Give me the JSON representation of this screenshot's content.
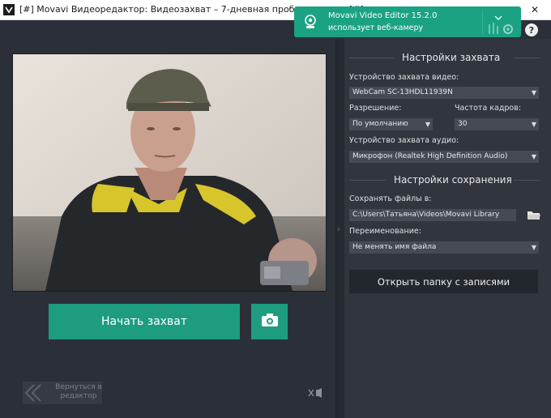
{
  "window": {
    "title": "[#] Movavi Видеоредактор: Видеозахват – 7-дневная пробная версия [#]",
    "minimize_glyph": "—",
    "close_glyph": "✕"
  },
  "notification": {
    "title": "Movavi Video Editor 15.2.0",
    "subtitle": "использует веб-камеру",
    "icon": "webcam-icon"
  },
  "help_glyph": "?",
  "capture": {
    "start_label": "Начать захват",
    "snapshot_icon": "camera-icon"
  },
  "back": {
    "label": "Вернуться в редактор",
    "icon": "double-chevron-left-icon"
  },
  "right_panel": {
    "capture_settings_title": "Настройки захвата",
    "video_device_label": "Устройство захвата видео:",
    "video_device_value": "WebCam SC-13HDL11939N",
    "resolution_label": "Разрешение:",
    "resolution_value": "По умолчанию",
    "framerate_label": "Частота кадров:",
    "framerate_value": "30",
    "audio_device_label": "Устройство захвата аудио:",
    "audio_device_value": "Микрофон (Realtek High Definition Audio)",
    "save_settings_title": "Настройки сохранения",
    "save_to_label": "Сохранять файлы в:",
    "save_path": "C:\\Users\\Татьяна\\Videos\\Movavi Library",
    "rename_label": "Переименование:",
    "rename_value": "Не менять имя файла",
    "open_folder_label": "Открыть папку с записями"
  },
  "colors": {
    "accent": "#1d9c80",
    "notify": "#1aa283",
    "background": "#2b3038",
    "panel": "#30353e"
  }
}
